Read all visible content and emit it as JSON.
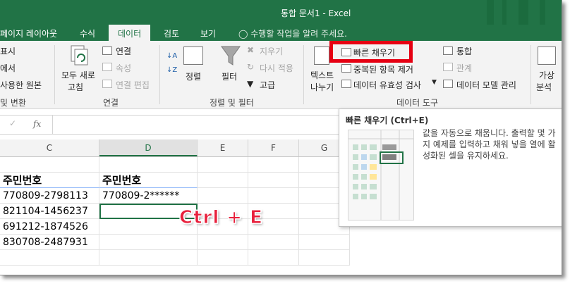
{
  "window": {
    "title": "통합 문서1 - Excel"
  },
  "tabs": [
    {
      "label": "페이지 레이아웃",
      "active": false
    },
    {
      "label": "수식",
      "active": false
    },
    {
      "label": "데이터",
      "active": true
    },
    {
      "label": "검토",
      "active": false
    },
    {
      "label": "보기",
      "active": false
    }
  ],
  "tell_me": "수행할 작업을 알려 주세요.",
  "ribbon": {
    "left_partial": [
      "표시",
      "에서",
      "사용한 원본"
    ],
    "left_group_label": "및 변환",
    "connections": {
      "refresh_all": [
        "모두 새로",
        "고침"
      ],
      "connections": "연결",
      "properties": "속성",
      "edit_links": "연결 편집",
      "group_label": "연결"
    },
    "sort_filter": {
      "sort": "정렬",
      "filter": "필터",
      "clear": "지우기",
      "reapply": "다시 적용",
      "advanced": "고급",
      "group_label": "정렬 및 필터"
    },
    "data_tools": {
      "text_to_columns": [
        "텍스트",
        "나누기"
      ],
      "flash_fill": "빠른 채우기",
      "remove_duplicates": "중복된 항목 제거",
      "data_validation": "데이터 유효성 검사",
      "consolidate": "통합",
      "relationships": "관계",
      "data_model": "데이터 모델 관리",
      "group_label": "데이터 도구"
    },
    "forecast": {
      "what_if": [
        "가상",
        "분석"
      ]
    }
  },
  "formula_bar": {
    "fx": "fx",
    "value": ""
  },
  "columns": [
    "C",
    "D",
    "E",
    "F",
    "G"
  ],
  "sheet": {
    "headers": [
      "주민번호",
      "주민번호"
    ],
    "rows": [
      [
        "770809-2798113",
        "770809-2******"
      ],
      [
        "821104-1456237",
        ""
      ],
      [
        "691212-1874526",
        ""
      ],
      [
        "830708-2487931",
        ""
      ]
    ]
  },
  "tooltip": {
    "title": "빠른 채우기 (Ctrl+E)",
    "description": "값을 자동으로 채웁니다. 출력할 몇 가지 예제를 입력하고 채워 넣을 열에 활성화된 셀을 유지하세요."
  },
  "annotation": {
    "text": "Ctrl + E",
    "color": "#e8203c"
  },
  "colors": {
    "excel_green": "#217346",
    "highlight": "#e60012"
  }
}
